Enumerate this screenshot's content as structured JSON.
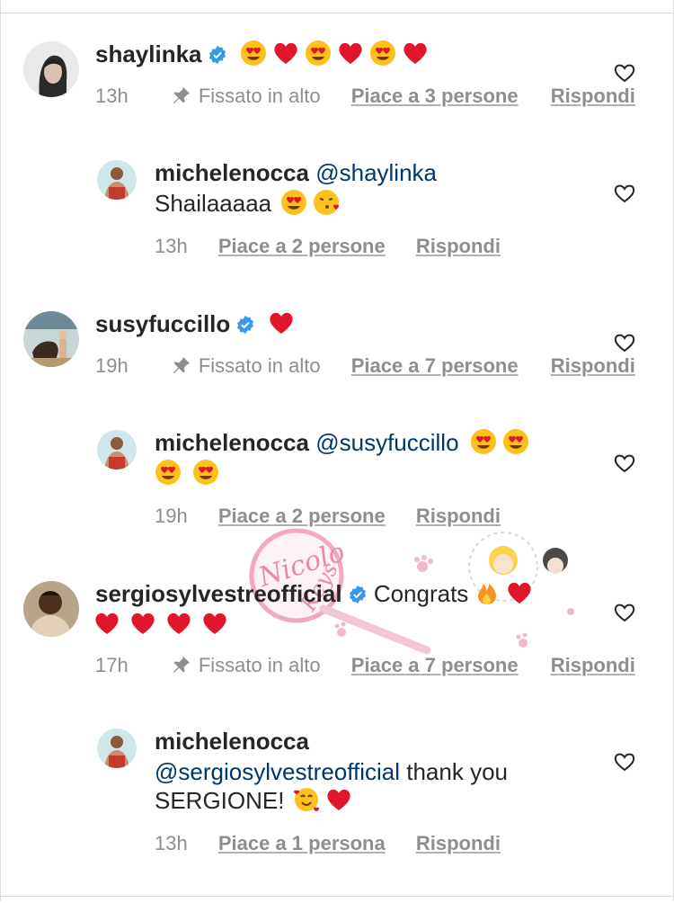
{
  "comments": [
    {
      "username": "shaylinka",
      "verified": true,
      "time": "13h",
      "pinned": "Fissato in alto",
      "likes": "Piace a 3 persone",
      "reply": "Rispondi"
    },
    {
      "username": "michelenocca",
      "mention": "@shaylinka",
      "text": "Shailaaaaa",
      "time": "13h",
      "likes": "Piace a 2 persone",
      "reply": "Rispondi"
    },
    {
      "username": "susyfuccillo",
      "verified": true,
      "time": "19h",
      "pinned": "Fissato in alto",
      "likes": "Piace a 7 persone",
      "reply": "Rispondi"
    },
    {
      "username": "michelenocca",
      "mention": "@susyfuccillo",
      "time": "19h",
      "likes": "Piace a 2 persone",
      "reply": "Rispondi"
    },
    {
      "username": "sergiosylvestreofficial",
      "verified": true,
      "text": "Congrats",
      "time": "17h",
      "pinned": "Fissato in alto",
      "likes": "Piace a 7 persone",
      "reply": "Rispondi"
    },
    {
      "username": "michelenocca",
      "mention": "@sergiosylvestreofficial",
      "text": "thank you",
      "text2": "SERGIONE!",
      "time": "13h",
      "likes": "Piace a 1 persona",
      "reply": "Rispondi"
    }
  ],
  "watermark": {
    "text": "Nicolo Keys"
  },
  "colors": {
    "verified_blue": "#3897f0",
    "mention": "#00376b",
    "meta_gray": "#8e8e8e",
    "heart_red": "#e0162b"
  }
}
